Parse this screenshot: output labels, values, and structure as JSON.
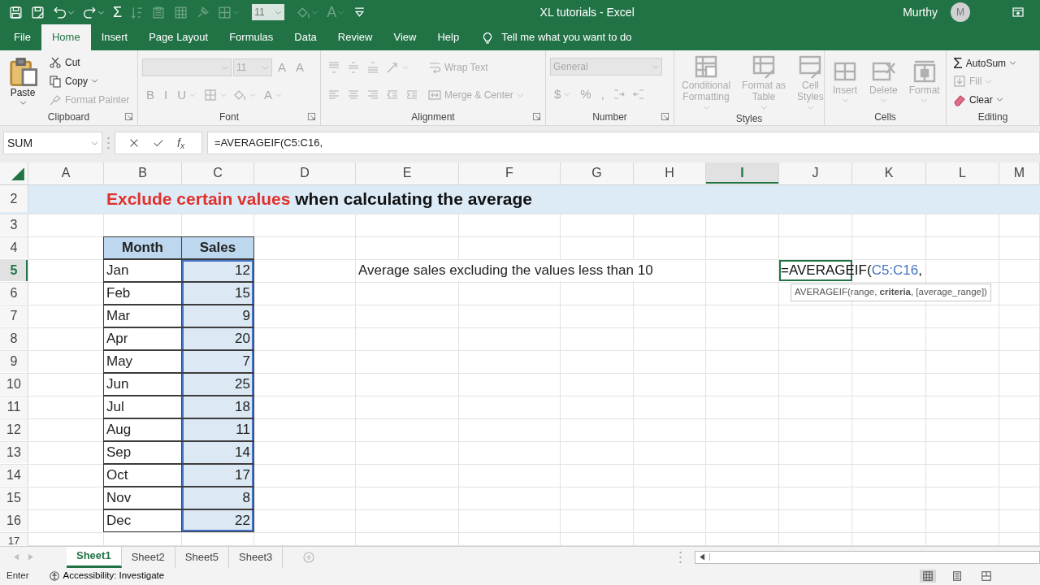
{
  "window": {
    "title": "XL tutorials  -  Excel",
    "user": "Murthy",
    "avatar": "M"
  },
  "quick_access": [
    {
      "kind": "icon",
      "disabled": false,
      "dropdown": false
    },
    {
      "kind": "icon",
      "disabled": false,
      "dropdown": false
    },
    {
      "kind": "icon",
      "disabled": false,
      "dropdown": true
    },
    {
      "kind": "icon",
      "disabled": false,
      "dropdown": true
    },
    {
      "kind": "glyph",
      "text": "Σ",
      "disabled": false,
      "dropdown": false
    },
    {
      "kind": "icon",
      "disabled": true,
      "dropdown": false
    },
    {
      "kind": "icon",
      "disabled": true,
      "dropdown": false
    },
    {
      "kind": "icon",
      "disabled": true,
      "dropdown": false
    },
    {
      "kind": "icon",
      "disabled": true,
      "dropdown": false
    },
    {
      "kind": "icon",
      "disabled": true,
      "dropdown": true
    },
    {
      "kind": "combo",
      "value": "11",
      "disabled": true
    },
    {
      "kind": "icon",
      "disabled": true,
      "dropdown": true
    },
    {
      "kind": "glyph",
      "text": "A",
      "disabled": true,
      "dropdown": true
    },
    {
      "kind": "icon",
      "disabled": false,
      "dropdown": false
    }
  ],
  "tabs": [
    {
      "label": "File",
      "selected": false
    },
    {
      "label": "Home",
      "selected": true
    },
    {
      "label": "Insert",
      "selected": false
    },
    {
      "label": "Page Layout",
      "selected": false
    },
    {
      "label": "Formulas",
      "selected": false
    },
    {
      "label": "Data",
      "selected": false
    },
    {
      "label": "Review",
      "selected": false
    },
    {
      "label": "View",
      "selected": false
    },
    {
      "label": "Help",
      "selected": false
    }
  ],
  "tell_me": "Tell me what you want to do",
  "ribbon": [
    {
      "label": "Clipboard",
      "launcher": true,
      "stacks": [
        [
          [
            {
              "kind": "large",
              "lines": [
                "Paste"
              ],
              "disabled": false,
              "dropdown": true
            }
          ]
        ],
        [
          [
            {
              "kind": "small",
              "label": "Cut",
              "disabled": false,
              "dropdown": false
            }
          ],
          [
            {
              "kind": "small",
              "label": "Copy",
              "disabled": false,
              "dropdown": true
            }
          ],
          [
            {
              "kind": "small",
              "label": "Format Painter",
              "disabled": true,
              "dropdown": false
            }
          ]
        ]
      ]
    },
    {
      "label": "Font",
      "launcher": true,
      "stacks": [
        [
          [
            {
              "kind": "wide_combo",
              "disabled": true
            },
            {
              "kind": "combo",
              "value": "11",
              "disabled": true
            },
            {
              "kind": "glyph",
              "text": "A",
              "disabled": true,
              "dropdown": false
            },
            {
              "kind": "glyph",
              "text": "A",
              "disabled": true,
              "dropdown": false
            }
          ],
          [
            {
              "kind": "glyph",
              "text": "B",
              "disabled": true,
              "dropdown": false
            },
            {
              "kind": "glyph",
              "text": "I",
              "disabled": true,
              "dropdown": false
            },
            {
              "kind": "glyph",
              "text": "U",
              "disabled": true,
              "dropdown": true
            },
            {
              "kind": "icon",
              "disabled": true,
              "dropdown": true
            },
            {
              "kind": "icon",
              "disabled": true,
              "dropdown": true
            },
            {
              "kind": "glyph",
              "text": "A",
              "disabled": true,
              "dropdown": true
            }
          ]
        ]
      ]
    },
    {
      "label": "Alignment",
      "launcher": true,
      "stacks": [
        [
          [
            {
              "kind": "icon",
              "disabled": true,
              "dropdown": false
            },
            {
              "kind": "icon",
              "disabled": true,
              "dropdown": false
            },
            {
              "kind": "icon",
              "disabled": true,
              "dropdown": false
            },
            {
              "kind": "icon",
              "disabled": true,
              "dropdown": true
            }
          ],
          [
            {
              "kind": "icon",
              "disabled": true,
              "dropdown": false
            },
            {
              "kind": "icon",
              "disabled": true,
              "dropdown": false
            },
            {
              "kind": "icon",
              "disabled": true,
              "dropdown": false
            },
            {
              "kind": "icon",
              "disabled": true,
              "dropdown": false
            },
            {
              "kind": "icon",
              "disabled": true,
              "dropdown": false
            }
          ]
        ],
        [
          [
            {
              "kind": "small",
              "label": "Wrap Text",
              "disabled": true,
              "dropdown": false
            }
          ],
          [
            {
              "kind": "small",
              "label": "Merge & Center",
              "disabled": true,
              "dropdown": true
            }
          ]
        ]
      ]
    },
    {
      "label": "Number",
      "launcher": true,
      "stacks": [
        [
          [
            {
              "kind": "wide_combo",
              "value": "General",
              "disabled": true
            }
          ],
          [
            {
              "kind": "glyph",
              "text": "$",
              "disabled": true,
              "dropdown": true
            },
            {
              "kind": "glyph",
              "text": "%",
              "disabled": true,
              "dropdown": false
            },
            {
              "kind": "glyph",
              "text": ",",
              "disabled": true,
              "dropdown": false
            },
            {
              "kind": "icon",
              "disabled": true,
              "dropdown": false
            },
            {
              "kind": "icon",
              "disabled": true,
              "dropdown": false
            }
          ]
        ]
      ]
    },
    {
      "label": "Styles",
      "launcher": false,
      "stacks": [
        [
          [
            {
              "kind": "large",
              "lines": [
                "Conditional",
                "Formatting"
              ],
              "disabled": true,
              "dropdown": true
            }
          ]
        ],
        [
          [
            {
              "kind": "large",
              "lines": [
                "Format as",
                "Table"
              ],
              "disabled": true,
              "dropdown": true
            }
          ]
        ],
        [
          [
            {
              "kind": "large",
              "lines": [
                "Cell",
                "Styles"
              ],
              "disabled": true,
              "dropdown": true
            }
          ]
        ]
      ]
    },
    {
      "label": "Cells",
      "launcher": false,
      "stacks": [
        [
          [
            {
              "kind": "large",
              "lines": [
                "Insert"
              ],
              "disabled": true,
              "dropdown": true
            }
          ]
        ],
        [
          [
            {
              "kind": "large",
              "lines": [
                "Delete"
              ],
              "disabled": true,
              "dropdown": true
            }
          ]
        ],
        [
          [
            {
              "kind": "large",
              "lines": [
                "Format"
              ],
              "disabled": true,
              "dropdown": true
            }
          ]
        ]
      ]
    },
    {
      "label": "Editing",
      "launcher": false,
      "stacks": [
        [
          [
            {
              "kind": "small",
              "glyph": "Σ",
              "label": "AutoSum",
              "disabled": false,
              "dropdown": true
            }
          ],
          [
            {
              "kind": "small",
              "label": "Fill",
              "disabled": true,
              "dropdown": true
            }
          ],
          [
            {
              "kind": "small",
              "label": "Clear",
              "disabled": false,
              "dropdown": true
            }
          ]
        ]
      ]
    }
  ],
  "formula_bar": {
    "name_box": "SUM",
    "function_label": "f$_{x}$",
    "formula": "=AVERAGEIF(C5:C16,"
  },
  "sheet": {
    "columns": [
      {
        "label": "A",
        "selected": false
      },
      {
        "label": "B",
        "selected": false
      },
      {
        "label": "C",
        "selected": false
      },
      {
        "label": "D",
        "selected": false
      },
      {
        "label": "E",
        "selected": false
      },
      {
        "label": "F",
        "selected": false
      },
      {
        "label": "G",
        "selected": false
      },
      {
        "label": "H",
        "selected": false
      },
      {
        "label": "I",
        "selected": true
      },
      {
        "label": "J",
        "selected": false
      },
      {
        "label": "K",
        "selected": false
      },
      {
        "label": "L",
        "selected": false
      },
      {
        "label": "M",
        "selected": false
      }
    ],
    "rows": [
      {
        "number": "2",
        "selected": false
      },
      {
        "number": "3",
        "selected": false
      },
      {
        "number": "4",
        "selected": false
      },
      {
        "number": "5",
        "selected": true
      },
      {
        "number": "6",
        "selected": false
      },
      {
        "number": "7",
        "selected": false
      },
      {
        "number": "8",
        "selected": false
      },
      {
        "number": "9",
        "selected": false
      },
      {
        "number": "10",
        "selected": false
      },
      {
        "number": "11",
        "selected": false
      },
      {
        "number": "12",
        "selected": false
      },
      {
        "number": "13",
        "selected": false
      },
      {
        "number": "14",
        "selected": false
      },
      {
        "number": "15",
        "selected": false
      },
      {
        "number": "16",
        "selected": false
      },
      {
        "number": "17",
        "selected": false
      }
    ],
    "title": [
      {
        "text": "Exclude certain values",
        "highlight": true
      },
      {
        "text": " when calculating the average",
        "highlight": false
      }
    ],
    "table": {
      "headers": [
        "Month",
        "Sales"
      ],
      "rows": [
        {
          "month": "Jan",
          "sales": "12",
          "referenced": true
        },
        {
          "month": "Feb",
          "sales": "15",
          "referenced": true
        },
        {
          "month": "Mar",
          "sales": "9",
          "referenced": true
        },
        {
          "month": "Apr",
          "sales": "20",
          "referenced": true
        },
        {
          "month": "May",
          "sales": "7",
          "referenced": true
        },
        {
          "month": "Jun",
          "sales": "25",
          "referenced": true
        },
        {
          "month": "Jul",
          "sales": "18",
          "referenced": true
        },
        {
          "month": "Aug",
          "sales": "11",
          "referenced": true
        },
        {
          "month": "Sep",
          "sales": "14",
          "referenced": true
        },
        {
          "month": "Oct",
          "sales": "17",
          "referenced": true
        },
        {
          "month": "Nov",
          "sales": "8",
          "referenced": true
        },
        {
          "month": "Dec",
          "sales": "22",
          "referenced": true
        }
      ]
    },
    "note": "Average sales excluding the values less than 10",
    "editor": {
      "parts": [
        {
          "text": "=AVERAGEIF(",
          "reference": false
        },
        {
          "text": "C5:C16",
          "reference": true
        },
        {
          "text": ",",
          "reference": false
        }
      ],
      "hint": "AVERAGEIF(range, **criteria**, [average_range])"
    }
  },
  "sheet_tabs": [
    {
      "label": "Sheet1",
      "selected": true
    },
    {
      "label": "Sheet2",
      "selected": false
    },
    {
      "label": "Sheet5",
      "selected": false
    },
    {
      "label": "Sheet3",
      "selected": false
    }
  ],
  "status_bar": {
    "mode": "Enter",
    "accessibility": "Accessibility: Investigate",
    "views": [
      {
        "selected": true
      },
      {
        "selected": false
      },
      {
        "selected": false
      }
    ]
  }
}
